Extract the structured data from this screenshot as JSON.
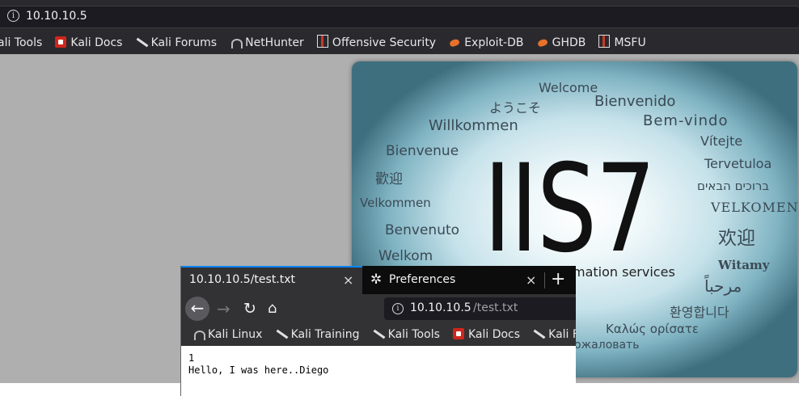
{
  "bg_browser": {
    "url": "10.10.10.5",
    "bookmarks": [
      {
        "label": "ali Tools",
        "icon": "none"
      },
      {
        "label": "Kali Docs",
        "icon": "kali-docs-icon"
      },
      {
        "label": "Kali Forums",
        "icon": "kali-forums-icon"
      },
      {
        "label": "NetHunter",
        "icon": "nethunter-icon"
      },
      {
        "label": "Offensive Security",
        "icon": "offsec-icon"
      },
      {
        "label": "Exploit-DB",
        "icon": "exploit-db-icon"
      },
      {
        "label": "GHDB",
        "icon": "ghdb-icon"
      },
      {
        "label": "MSFU",
        "icon": "msfu-icon"
      }
    ]
  },
  "iis": {
    "big": "IIS7",
    "words": [
      "Welcome",
      "ようこそ",
      "Bienvenido",
      "Willkommen",
      "Bem-vindo",
      "Vítejte",
      "Bienvenue",
      "Tervetuloa",
      "歡迎",
      "ברוכים הבאים",
      "Velkommen",
      "VELKOMEN",
      "欢迎",
      "Benvenuto",
      "Witamy",
      "Welkom",
      "مرحباً",
      "mation services",
      "환영합니다",
      "Καλώς ορίσατε",
      "ожаловать"
    ]
  },
  "fg_browser": {
    "tabs": [
      {
        "label": "10.10.10.5/test.txt",
        "close": "×"
      },
      {
        "label": "Preferences",
        "close": "×"
      }
    ],
    "new_tab": "+",
    "url_host": "10.10.10.5",
    "url_path": "/test.txt",
    "bookmarks": [
      {
        "label": "Kali Linux",
        "icon": "kali-linux-icon"
      },
      {
        "label": "Kali Training",
        "icon": "kali-training-icon"
      },
      {
        "label": "Kali Tools",
        "icon": "kali-tools-icon"
      },
      {
        "label": "Kali Docs",
        "icon": "kali-docs-icon"
      },
      {
        "label": "Kali Foru",
        "icon": "kali-forums-icon"
      }
    ],
    "content": "1\nHello, I was here..Diego"
  },
  "colors": {
    "chrome_dark": "#2a2a2e",
    "url_bar": "#1c1b22",
    "tab_active": "#323234",
    "tab_accent": "#0a84ff",
    "page_bg": "#afafaf"
  }
}
